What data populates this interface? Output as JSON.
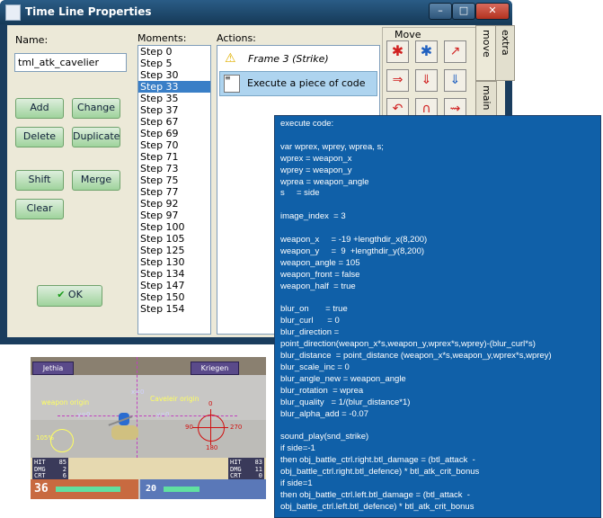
{
  "window": {
    "title": "Time Line Properties"
  },
  "name_panel": {
    "label": "Name:",
    "value": "tml_atk_cavelier"
  },
  "buttons": {
    "add": "Add",
    "change": "Change",
    "delete": "Delete",
    "duplicate": "Duplicate",
    "shift": "Shift",
    "merge": "Merge",
    "clear": "Clear",
    "ok": "OK"
  },
  "moments": {
    "label": "Moments:",
    "items": [
      "Step 0",
      "Step 5",
      "Step 30",
      "Step 33",
      "Step 35",
      "Step 37",
      "Step 67",
      "Step 69",
      "Step 70",
      "Step 71",
      "Step 73",
      "Step 75",
      "Step 77",
      "Step 92",
      "Step 97",
      "Step 100",
      "Step 105",
      "Step 125",
      "Step 130",
      "Step 134",
      "Step 147",
      "Step 150",
      "Step 154"
    ],
    "selected": "Step 33"
  },
  "actions": {
    "label": "Actions:",
    "items": [
      {
        "text": "Frame 3 (Strike)",
        "icon": "warning-icon"
      },
      {
        "text": "Execute a piece of code",
        "icon": "document-icon"
      }
    ]
  },
  "tools": {
    "group_label": "Move",
    "tabs": [
      "move",
      "extra",
      "main"
    ]
  },
  "code": {
    "lines": [
      "execute code:",
      "",
      "var wprex, wprey, wprea, s;",
      "wprex = weapon_x",
      "wprey = weapon_y",
      "wprea = weapon_angle",
      "s     = side",
      "",
      "image_index  = 3",
      "",
      "weapon_x     = -19 +lengthdir_x(8,200)",
      "weapon_y     =  9  +lengthdir_y(8,200)",
      "weapon_angle = 105",
      "weapon_front = false",
      "weapon_half  = true",
      "",
      "blur_on       = true",
      "blur_curl      = 0",
      "blur_direction =",
      "point_direction(weapon_x*s,weapon_y,wprex*s,wprey)-(blur_curl*s)",
      "blur_distance  = point_distance (weapon_x*s,weapon_y,wprex*s,wprey)",
      "blur_scale_inc = 0",
      "blur_angle_new = weapon_angle",
      "blur_rotation  = wprea",
      "blur_quality   = 1/(blur_distance*1)",
      "blur_alpha_add = -0.07",
      "",
      "sound_play(snd_strike)",
      "if side=-1",
      "then obj_battle_ctrl.right.btl_damage = (btl_attack  -",
      "obj_battle_ctrl.right.btl_defence) * btl_atk_crit_bonus",
      "if side=1",
      "then obj_battle_ctrl.left.btl_damage = (btl_attack  -",
      "obj_battle_ctrl.left.btl_defence) * btl_atk_crit_bonus"
    ]
  },
  "game": {
    "left_name": "Jethia",
    "right_name": "Kriegen",
    "annotations": {
      "weapon_origin": "weapon origin",
      "caveleir_origin": "Caveleir origin",
      "x0": "x=0",
      "y0a": "y=0",
      "y0b": "y=0",
      "percent": "105%",
      "deg0": "0",
      "deg90": "90",
      "deg180": "180",
      "deg270": "270"
    },
    "left_stats": [
      {
        "k": "HIT",
        "v": "85"
      },
      {
        "k": "DMG",
        "v": "2"
      },
      {
        "k": "CRT",
        "v": "6"
      }
    ],
    "right_stats": [
      {
        "k": "HIT",
        "v": "83"
      },
      {
        "k": "DMG",
        "v": "11"
      },
      {
        "k": "CRT",
        "v": "0"
      }
    ],
    "left_hp": "36",
    "right_hp": "20"
  }
}
